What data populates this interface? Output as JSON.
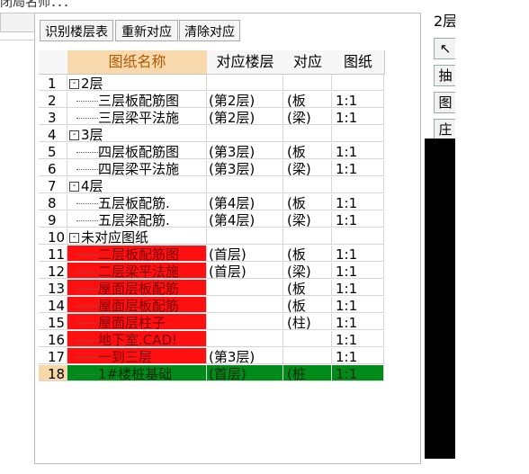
{
  "window": {
    "title_fragment": "闭局名师：：："
  },
  "toolbar": {
    "identify_btn": "识别楼层表",
    "rematch_btn": "重新对应",
    "clear_btn": "清除对应"
  },
  "table": {
    "headers": [
      "图纸名称",
      "对应楼层",
      "对应",
      "图纸"
    ],
    "rows": [
      {
        "num": "1",
        "toggle": "⊟",
        "name": "2层",
        "floor": "",
        "map": "",
        "ratio": "",
        "style": "group"
      },
      {
        "num": "2",
        "name": "三层板配筋图",
        "floor": "(第2层)",
        "map": "(板",
        "ratio": "1:1",
        "style": "child"
      },
      {
        "num": "3",
        "name": "三层梁平法施",
        "floor": "(第2层)",
        "map": "(梁)",
        "ratio": "1:1",
        "style": "child"
      },
      {
        "num": "4",
        "toggle": "⊟",
        "name": "3层",
        "floor": "",
        "map": "",
        "ratio": "",
        "style": "group"
      },
      {
        "num": "5",
        "name": "四层板配筋图",
        "floor": "(第3层)",
        "map": "(板",
        "ratio": "1:1",
        "style": "child"
      },
      {
        "num": "6",
        "name": "四层梁平法施",
        "floor": "(第3层)",
        "map": "(梁)",
        "ratio": "1:1",
        "style": "child"
      },
      {
        "num": "7",
        "toggle": "⊟",
        "name": "4层",
        "floor": "",
        "map": "",
        "ratio": "",
        "style": "group"
      },
      {
        "num": "8",
        "name": "五层板配筋.",
        "floor": "(第4层)",
        "map": "(板",
        "ratio": "1:1",
        "style": "child"
      },
      {
        "num": "9",
        "name": "五层梁配筋.",
        "floor": "(第4层)",
        "map": "(梁)",
        "ratio": "1:1",
        "style": "child"
      },
      {
        "num": "10",
        "toggle": "⊟",
        "name": "未对应图纸",
        "floor": "",
        "map": "",
        "ratio": "",
        "style": "group"
      },
      {
        "num": "11",
        "name": "二层板配筋图",
        "floor": "(首层)",
        "map": "(板",
        "ratio": "1:1",
        "style": "red"
      },
      {
        "num": "12",
        "name": "二层梁平法施",
        "floor": "(首层)",
        "map": "(梁)",
        "ratio": "1:1",
        "style": "red"
      },
      {
        "num": "13",
        "name": "屋面层板配筋",
        "floor": "",
        "map": "(板",
        "ratio": "1:1",
        "style": "red"
      },
      {
        "num": "14",
        "name": "屋面层板配筋",
        "floor": "",
        "map": "(板",
        "ratio": "1:1",
        "style": "red"
      },
      {
        "num": "15",
        "name": "屋面层柱子",
        "floor": "",
        "map": "(柱)",
        "ratio": "1:1",
        "style": "red"
      },
      {
        "num": "16",
        "name": "地下室.CAD!",
        "floor": "",
        "map": "",
        "ratio": "1:1",
        "style": "red"
      },
      {
        "num": "17",
        "name": "一到三层",
        "floor": "(第3层)",
        "map": "",
        "ratio": "1:1",
        "style": "red"
      },
      {
        "num": "18",
        "name": "1#楼桩基础",
        "floor": "(首层)",
        "map": "(桩",
        "ratio": "1:1",
        "style": "green"
      }
    ]
  },
  "right_panel": {
    "floor_label": "2层",
    "tool1": "↖",
    "tool2": "抽",
    "tool3": "图",
    "tool4": "庄"
  },
  "colors": {
    "unmatched": "#ff1010",
    "selected": "#008a1a",
    "header_accent": "#d6a25a"
  }
}
